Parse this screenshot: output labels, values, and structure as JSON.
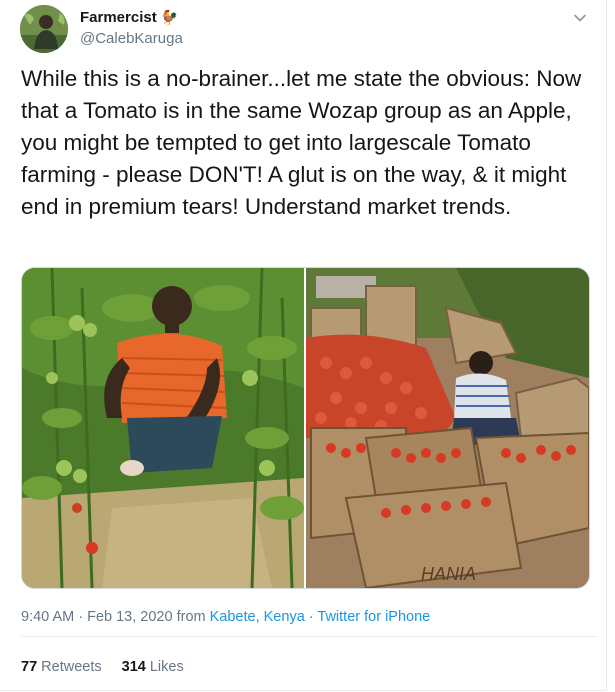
{
  "author": {
    "display_name": "Farmercist",
    "badge": "🐓",
    "handle": "@CalebKaruga"
  },
  "tweet": {
    "text": "While this is a no-brainer...let me state the obvious: Now that a Tomato is in the same Wozap group as an Apple, you might be tempted to get into largescale Tomato farming - please DON'T! A glut is on the way, & it might end in premium tears! Understand market trends."
  },
  "meta": {
    "time": "9:40 AM",
    "sep1": " · ",
    "date": "Feb 13, 2020",
    "from": " from ",
    "location": "Kabete, Kenya",
    "sep2": " · ",
    "source": "Twitter for iPhone"
  },
  "stats": {
    "retweets_count": "77",
    "retweets_label": "Retweets",
    "likes_count": "314",
    "likes_label": "Likes"
  },
  "media": {
    "crate_text": "HANIA"
  },
  "colors": {
    "link": "#1b95e0",
    "secondary_text": "#657786",
    "tomato": "#d63a25"
  },
  "icons": {
    "more": "chevron-down-icon"
  }
}
